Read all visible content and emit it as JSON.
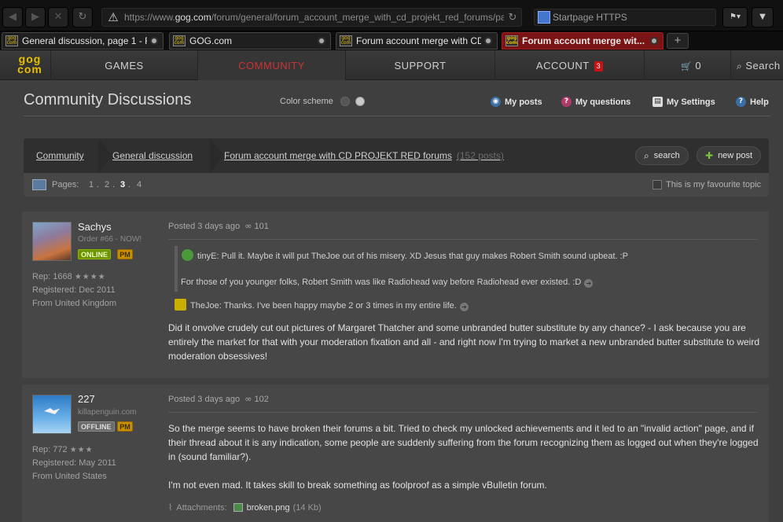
{
  "browser": {
    "url_scheme": "https://www.",
    "url_domain": "gog.com",
    "url_path": "/forum/general/forum_account_merge_with_cd_projekt_red_forums/pag",
    "search_engine": "Startpage HTTPS",
    "tabs": [
      {
        "label": "General discussion, page 1 - F..."
      },
      {
        "label": "GOG.com"
      },
      {
        "label": "Forum account merge with CD ..."
      },
      {
        "label": "Forum account merge wit..."
      }
    ]
  },
  "site_nav": {
    "logo_top": "gog",
    "logo_bottom": "com",
    "games": "GAMES",
    "community": "COMMUNITY",
    "support": "SUPPORT",
    "account": "ACCOUNT",
    "account_badge": "3",
    "cart_count": "0",
    "search": "Search"
  },
  "community": {
    "title": "Community Discussions",
    "color_scheme_label": "Color scheme",
    "my_posts": "My posts",
    "my_questions": "My questions",
    "my_settings": "My Settings",
    "help": "Help"
  },
  "breadcrumb": {
    "community": "Community",
    "general": "General discussion",
    "thread": "Forum account merge with CD PROJEKT RED forums",
    "posts": "(152 posts)",
    "search_btn": "search",
    "new_post_btn": "new post"
  },
  "pagination": {
    "label": "Pages:",
    "pages": [
      "1",
      "2",
      "3",
      "4"
    ],
    "separator": ".",
    "favourite_label": "This is my favourite topic"
  },
  "posts": [
    {
      "username": "Sachys",
      "usertitle": "Order #66 - NOW!",
      "status": "ONLINE",
      "pm": "PM",
      "rep": "Rep: 1668",
      "stars": "★★★★",
      "registered": "Registered: Dec 2011",
      "from": "From United Kingdom",
      "posted": "Posted 3 days ago",
      "post_no": "101",
      "quote1_author": "tinyE:",
      "quote1_text": "Pull it. Maybe it will put TheJoe out of his misery. XD Jesus that guy makes Robert Smith sound upbeat. :P",
      "quote1_more": "For those of you younger folks, Robert Smith was like Radiohead way before Radiohead ever existed. :D",
      "quote2_author": "TheJoe:",
      "quote2_text": "Thanks. I've been happy maybe 2 or 3 times in my entire life.",
      "body": "Did it onvolve crudely cut out pictures of Margaret Thatcher and some unbranded butter substitute by any chance? - I ask because you are entirely the market for that with your moderation fixation and all - and right now I'm trying to market a new unbranded butter substitute to weird moderation obsessives!"
    },
    {
      "username": "227",
      "usertitle": "killapenguin.com",
      "status": "OFFLINE",
      "pm": "PM",
      "rep": "Rep: 772",
      "stars": "★★★",
      "registered": "Registered: May 2011",
      "from": "From United States",
      "posted": "Posted 3 days ago",
      "post_no": "102",
      "body1": "So the merge seems to have broken their forums a bit. Tried to check my unlocked achievements and it led to an \"invalid action\" page, and if their thread about it is any indication, some people are suddenly suffering from the forum recognizing them as logged out when they're logged in (sound familiar?).",
      "body2": "I'm not even mad. It takes skill to break something as foolproof as a simple vBulletin forum.",
      "attachments_label": "Attachments:",
      "attachment_file": "broken.png",
      "attachment_size": "(14 Kb)"
    }
  ],
  "colors": {
    "accent_red": "#cc3333",
    "online_green": "#7aa600",
    "pm_orange": "#c89000"
  }
}
